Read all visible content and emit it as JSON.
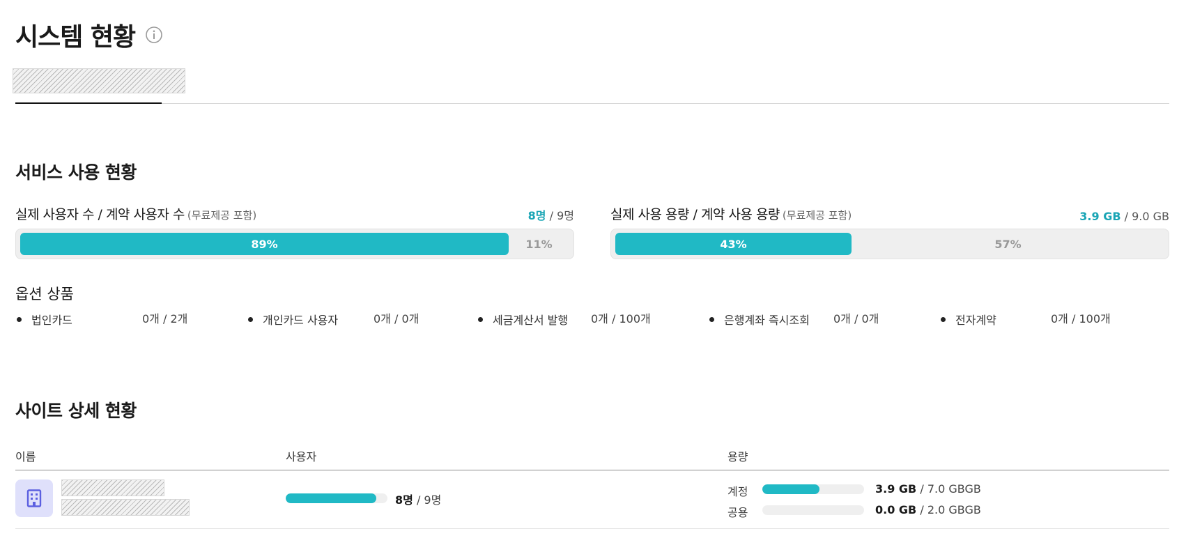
{
  "header": {
    "title": "시스템 현황",
    "info_icon": "info-circle-icon"
  },
  "tabs": {
    "active_tab": "redacted"
  },
  "service_usage": {
    "section_title": "서비스 사용 현황",
    "users": {
      "label": "실제 사용자 수 / 계약 사용자 수",
      "sub_label": "(무료제공 포함)",
      "actual": "8명",
      "contract": " / 9명",
      "used_percent": 89,
      "used_label": "89%",
      "remaining_label": "11%"
    },
    "storage": {
      "label": "실제 사용 용량 / 계약 사용 용량",
      "sub_label": "(무료제공 포함)",
      "actual": "3.9 GB",
      "contract": " / 9.0 GB",
      "used_percent": 43,
      "used_label": "43%",
      "remaining_label": "57%"
    }
  },
  "options": {
    "title": "옵션 상품",
    "items": [
      {
        "name": "법인카드",
        "value": "0개 / 2개"
      },
      {
        "name": "개인카드 사용자",
        "value": "0개 / 0개"
      },
      {
        "name": "세금계산서 발행",
        "value": "0개 / 100개"
      },
      {
        "name": "은행계좌 즉시조회",
        "value": "0개 / 0개"
      },
      {
        "name": "전자계약",
        "value": "0개 / 100개"
      }
    ]
  },
  "site_detail": {
    "section_title": "사이트 상세 현황",
    "columns": {
      "name": "이름",
      "users": "사용자",
      "capacity": "용량"
    },
    "rows": [
      {
        "avatar_icon": "building-icon",
        "users_fraction": 0.89,
        "users_actual": "8명",
        "users_total": " / 9명",
        "account_label": "계정",
        "account_fraction": 0.56,
        "account_actual": "3.9 GB",
        "account_total": " / 7.0 GBGB",
        "shared_label": "공용",
        "shared_fraction": 0.0,
        "shared_actual": "0.0 GB",
        "shared_total": " / 2.0 GBGB"
      }
    ]
  },
  "colors": {
    "accent": "#20b9c5",
    "accent_text": "#1aa5b5",
    "avatar_bg": "#dfe0fb",
    "avatar_icon": "#5b5fe0"
  }
}
